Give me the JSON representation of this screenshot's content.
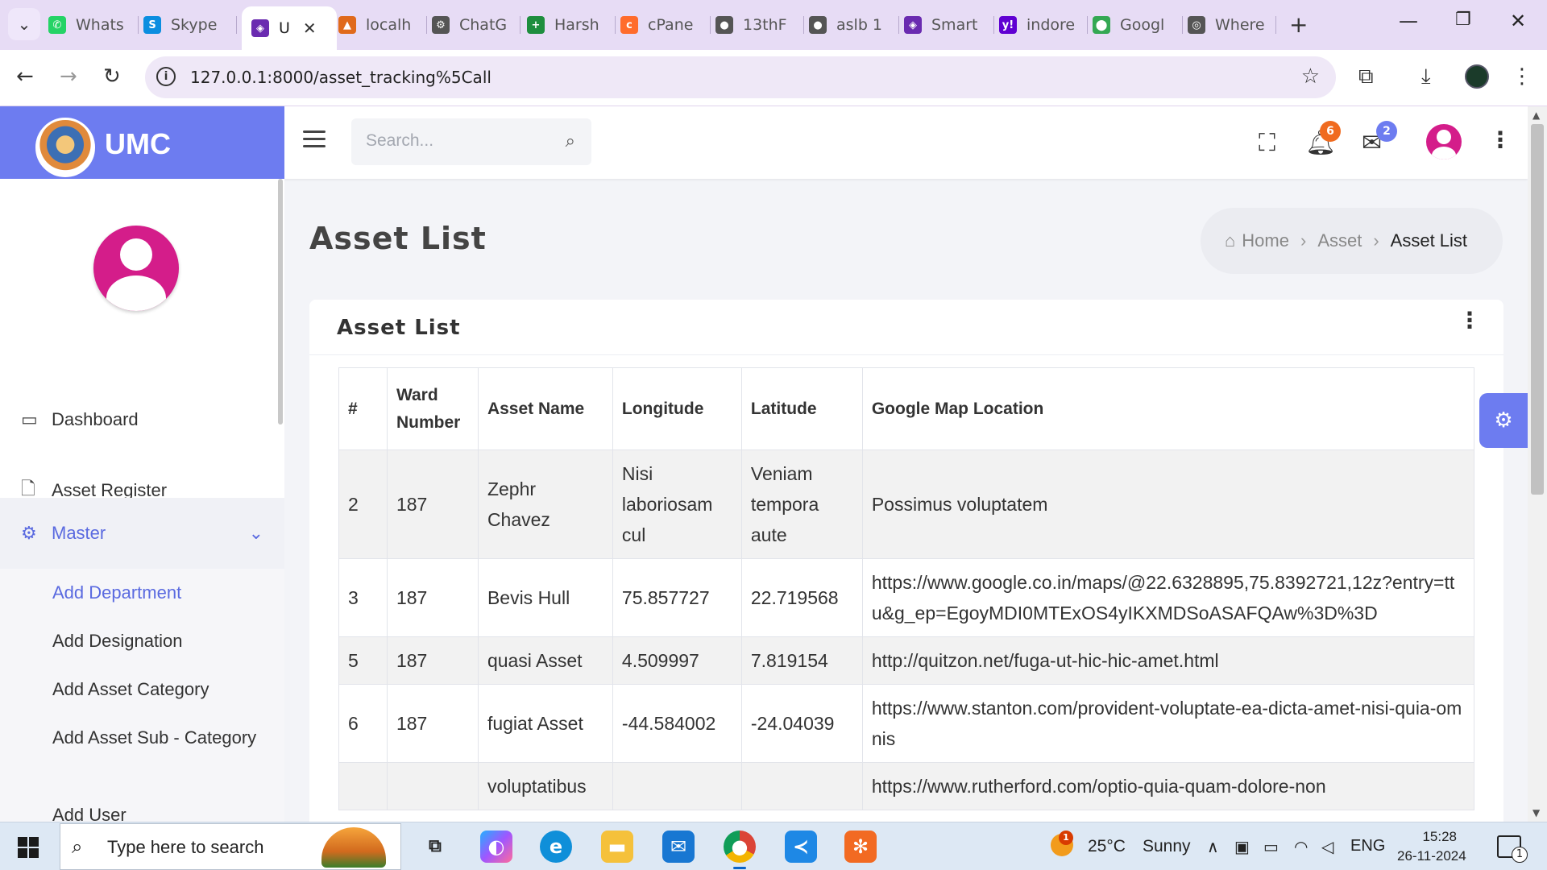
{
  "browser": {
    "tabs": [
      {
        "label": "Whats",
        "color": "#25d366",
        "glyph": "✆"
      },
      {
        "label": "Skype",
        "color": "#0b8ee0",
        "glyph": "S"
      },
      {
        "label": "U",
        "color": "#6a2bb0",
        "glyph": "◈",
        "active": true
      },
      {
        "label": "localh",
        "color": "#e06a1b",
        "glyph": "▲"
      },
      {
        "label": "ChatG",
        "color": "#555555",
        "glyph": "⚙"
      },
      {
        "label": "Harsh",
        "color": "#1e8e3e",
        "glyph": "+"
      },
      {
        "label": "cPane",
        "color": "#ff6c2c",
        "glyph": "c"
      },
      {
        "label": "13thF",
        "color": "#555555",
        "glyph": "●"
      },
      {
        "label": "aslb 1",
        "color": "#555555",
        "glyph": "●"
      },
      {
        "label": "Smart",
        "color": "#6a2bb0",
        "glyph": "◈"
      },
      {
        "label": "indore",
        "color": "#6001d2",
        "glyph": "y!"
      },
      {
        "label": "Googl",
        "color": "#34a853",
        "glyph": "⬤"
      },
      {
        "label": "Where",
        "color": "#555555",
        "glyph": "◎"
      }
    ],
    "url": "127.0.0.1:8000/asset_tracking%5Call"
  },
  "app": {
    "brand": "UMC",
    "search_placeholder": "Search...",
    "notifications_count": "6",
    "messages_count": "2",
    "accent": "#6d7cf0",
    "avatar_color": "#d41d8a"
  },
  "sidebar": {
    "items": [
      {
        "label": "Dashboard",
        "icon": "monitor-icon"
      },
      {
        "label": "Asset Register",
        "icon": "file-plus-icon"
      },
      {
        "label": "Master",
        "icon": "gear-icon"
      }
    ],
    "sub_items": [
      {
        "label": "Add Department",
        "active": true
      },
      {
        "label": "Add Designation"
      },
      {
        "label": "Add Asset Category"
      },
      {
        "label": "Add Asset Sub - Category"
      },
      {
        "label": "Add User"
      }
    ]
  },
  "page": {
    "title": "Asset List",
    "breadcrumb": [
      "Home",
      "Asset",
      "Asset List"
    ],
    "card_title": "Asset List"
  },
  "table": {
    "headers": [
      "#",
      "Ward Number",
      "Asset Name",
      "Longitude",
      "Latitude",
      "Google Map Location"
    ],
    "rows": [
      [
        "2",
        "187",
        "Zephr Chavez",
        "Nisi laboriosam cul",
        "Veniam tempora aute",
        "Possimus voluptatem"
      ],
      [
        "3",
        "187",
        "Bevis Hull",
        "75.857727",
        "22.719568",
        "https://www.google.co.in/maps/@22.6328895,75.8392721,12z?entry=ttu&g_ep=EgoyMDI0MTExOS4yIKXMDSoASAFQAw%3D%3D"
      ],
      [
        "5",
        "187",
        "quasi Asset",
        "4.509997",
        "7.819154",
        "http://quitzon.net/fuga-ut-hic-hic-amet.html"
      ],
      [
        "6",
        "187",
        "fugiat Asset",
        "-44.584002",
        "-24.04039",
        "https://www.stanton.com/provident-voluptate-ea-dicta-amet-nisi-quia-omnis"
      ],
      [
        "",
        "",
        "voluptatibus",
        "",
        "",
        "https://www.rutherford.com/optio-quia-quam-dolore-non"
      ]
    ]
  },
  "taskbar": {
    "search_text": "Type here to search",
    "temperature": "25°C",
    "weather": "Sunny",
    "language": "ENG",
    "time": "15:28",
    "date": "26-11-2024",
    "weather_badge": "1",
    "notification_count": "1"
  }
}
